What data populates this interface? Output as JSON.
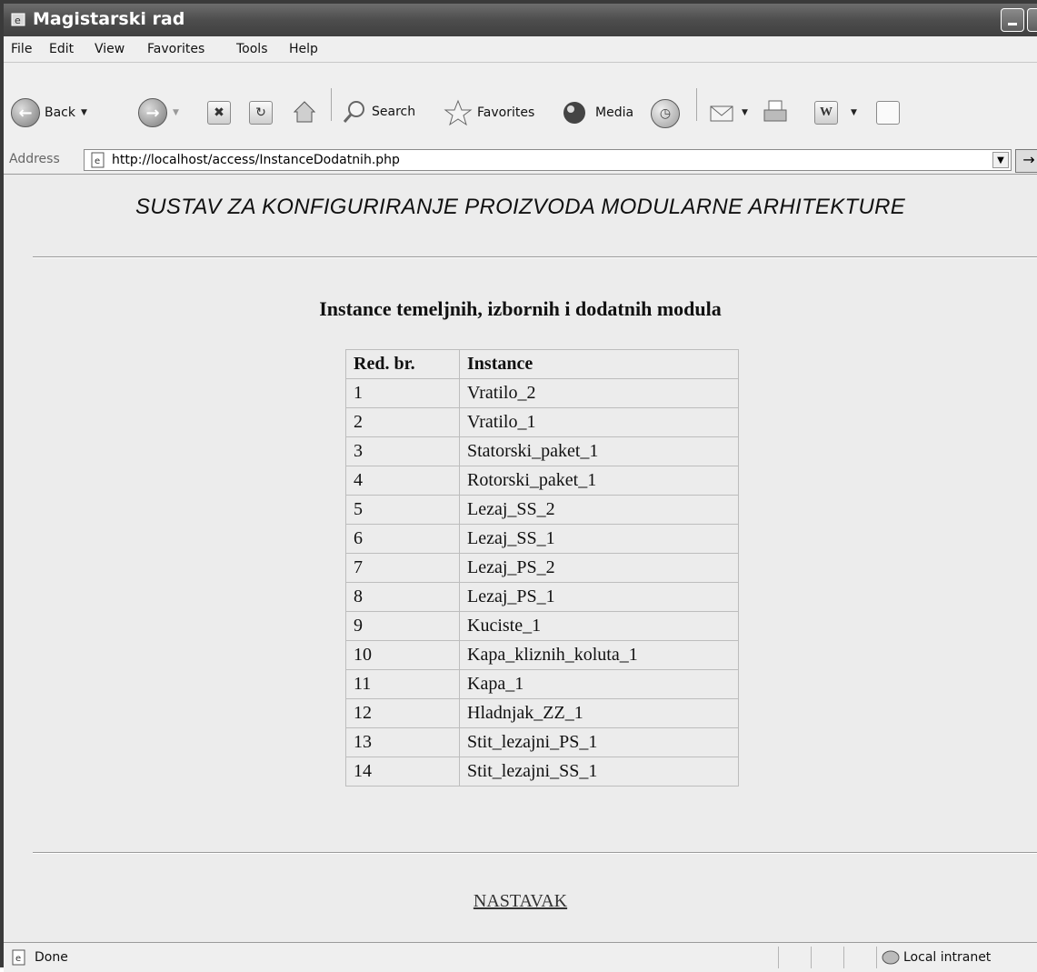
{
  "window": {
    "title": "Magistarski rad"
  },
  "menu": [
    "File",
    "Edit",
    "View",
    "Favorites",
    "Tools",
    "Help"
  ],
  "toolbar": {
    "back": "Back",
    "search": "Search",
    "favorites": "Favorites",
    "media": "Media"
  },
  "address": {
    "label": "Address",
    "url": "http://localhost/access/InstanceDodatnih.php"
  },
  "page": {
    "title": "SUSTAV ZA KONFIGURIRANJE PROIZVODA MODULARNE ARHITEKTURE",
    "heading": "Instance temeljnih, izbornih  i dodatnih modula",
    "table": {
      "headers": [
        "Red. br.",
        "Instance"
      ],
      "rows": [
        [
          "1",
          "Vratilo_2"
        ],
        [
          "2",
          "Vratilo_1"
        ],
        [
          "3",
          "Statorski_paket_1"
        ],
        [
          "4",
          "Rotorski_paket_1"
        ],
        [
          "5",
          "Lezaj_SS_2"
        ],
        [
          "6",
          "Lezaj_SS_1"
        ],
        [
          "7",
          "Lezaj_PS_2"
        ],
        [
          "8",
          "Lezaj_PS_1"
        ],
        [
          "9",
          "Kuciste_1"
        ],
        [
          "10",
          "Kapa_kliznih_koluta_1"
        ],
        [
          "11",
          "Kapa_1"
        ],
        [
          "12",
          "Hladnjak_ZZ_1"
        ],
        [
          "13",
          "Stit_lezajni_PS_1"
        ],
        [
          "14",
          "Stit_lezajni_SS_1"
        ]
      ]
    },
    "link": "NASTAVAK"
  },
  "status": {
    "text": "Done",
    "zone": "Local intranet"
  }
}
